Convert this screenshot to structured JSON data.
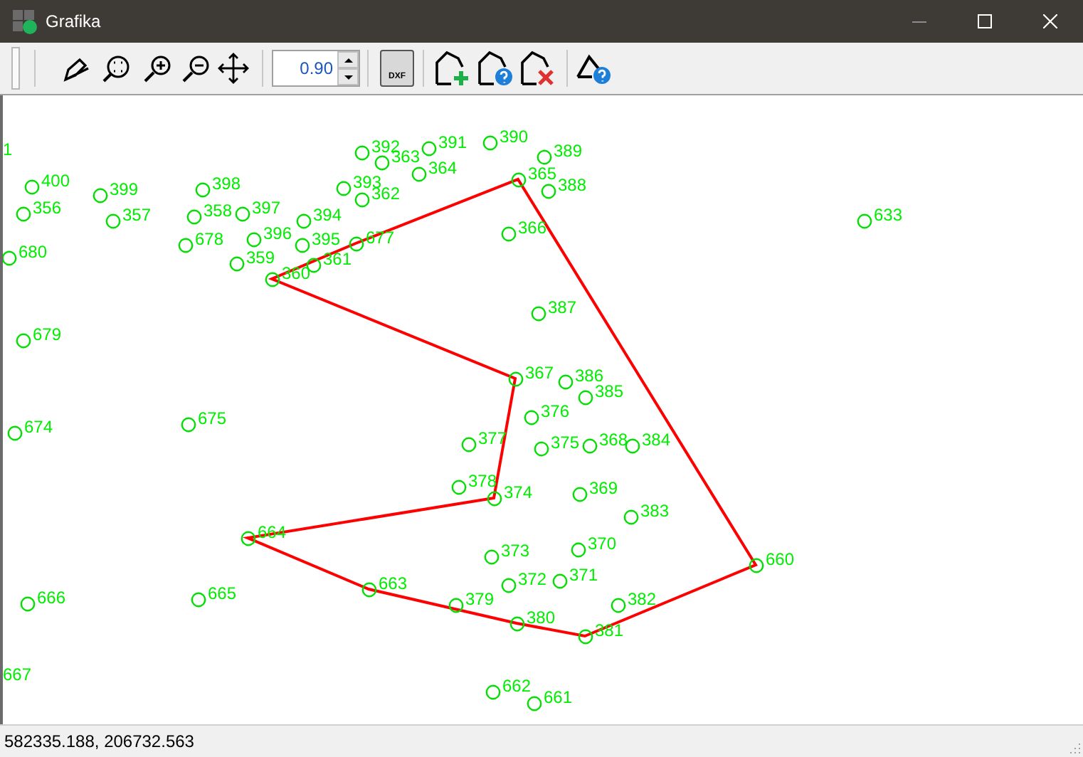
{
  "window": {
    "title": "Grafika"
  },
  "toolbar": {
    "scale": {
      "value": "0.90"
    },
    "dxf_button": {
      "label": "DXF"
    }
  },
  "points": [
    {
      "label": "1",
      "kind": "label_only"
    },
    {
      "label": "392",
      "kind": "marker"
    },
    {
      "label": "391",
      "kind": "marker"
    },
    {
      "label": "390",
      "kind": "marker"
    },
    {
      "label": "389",
      "kind": "marker"
    },
    {
      "label": "363",
      "kind": "marker"
    },
    {
      "label": "364",
      "kind": "marker"
    },
    {
      "label": "365",
      "kind": "marker"
    },
    {
      "label": "400",
      "kind": "marker"
    },
    {
      "label": "399",
      "kind": "marker"
    },
    {
      "label": "398",
      "kind": "marker"
    },
    {
      "label": "393",
      "kind": "marker"
    },
    {
      "label": "362",
      "kind": "marker"
    },
    {
      "label": "388",
      "kind": "marker"
    },
    {
      "label": "356",
      "kind": "marker"
    },
    {
      "label": "357",
      "kind": "marker"
    },
    {
      "label": "358",
      "kind": "marker"
    },
    {
      "label": "397",
      "kind": "marker"
    },
    {
      "label": "394",
      "kind": "marker"
    },
    {
      "label": "633",
      "kind": "marker"
    },
    {
      "label": "366",
      "kind": "marker"
    },
    {
      "label": "678",
      "kind": "marker"
    },
    {
      "label": "396",
      "kind": "marker"
    },
    {
      "label": "395",
      "kind": "marker"
    },
    {
      "label": "677",
      "kind": "marker"
    },
    {
      "label": "680",
      "kind": "marker"
    },
    {
      "label": "359",
      "kind": "marker"
    },
    {
      "label": "361",
      "kind": "marker"
    },
    {
      "label": "360",
      "kind": "marker"
    },
    {
      "label": "387",
      "kind": "marker"
    },
    {
      "label": "679",
      "kind": "marker"
    },
    {
      "label": "367",
      "kind": "marker"
    },
    {
      "label": "386",
      "kind": "marker"
    },
    {
      "label": "385",
      "kind": "marker"
    },
    {
      "label": "674",
      "kind": "marker"
    },
    {
      "label": "675",
      "kind": "marker"
    },
    {
      "label": "376",
      "kind": "marker"
    },
    {
      "label": "377",
      "kind": "marker"
    },
    {
      "label": "375",
      "kind": "marker"
    },
    {
      "label": "368",
      "kind": "marker"
    },
    {
      "label": "384",
      "kind": "marker"
    },
    {
      "label": "378",
      "kind": "marker"
    },
    {
      "label": "374",
      "kind": "marker"
    },
    {
      "label": "369",
      "kind": "marker"
    },
    {
      "label": "383",
      "kind": "marker"
    },
    {
      "label": "664",
      "kind": "marker"
    },
    {
      "label": "373",
      "kind": "marker"
    },
    {
      "label": "370",
      "kind": "marker"
    },
    {
      "label": "660",
      "kind": "marker"
    },
    {
      "label": "663",
      "kind": "marker"
    },
    {
      "label": "372",
      "kind": "marker"
    },
    {
      "label": "371",
      "kind": "marker"
    },
    {
      "label": "666",
      "kind": "marker"
    },
    {
      "label": "665",
      "kind": "marker"
    },
    {
      "label": "379",
      "kind": "marker"
    },
    {
      "label": "382",
      "kind": "marker"
    },
    {
      "label": "380",
      "kind": "marker"
    },
    {
      "label": "381",
      "kind": "marker"
    },
    {
      "label": "667",
      "kind": "label_only"
    },
    {
      "label": "662",
      "kind": "marker"
    },
    {
      "label": "661",
      "kind": "marker"
    }
  ],
  "status_bar": {
    "coordinates": "582335.188, 206732.563"
  }
}
